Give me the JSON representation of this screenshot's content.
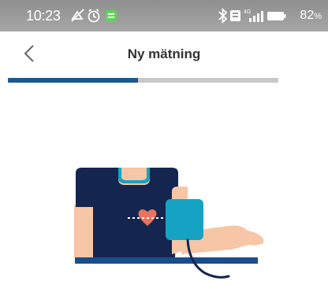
{
  "status_bar": {
    "time": "10:23",
    "battery_percent": "82",
    "network": "4G",
    "left_icons": [
      "notifications-off-icon",
      "alarm-icon",
      "app-notification-icon"
    ],
    "right_icons": [
      "bluetooth-icon",
      "nfc-icon",
      "signal-icon",
      "battery-icon"
    ]
  },
  "header": {
    "title": "Ny mätning",
    "back_icon": "chevron-left-icon"
  },
  "progress": {
    "fraction": 0.48,
    "fill_color": "#1a5a8e",
    "track_color": "#c8c8c8"
  },
  "illustration": {
    "subject": "person-with-blood-pressure-cuff",
    "colors": {
      "shirt": "#14264f",
      "skin": "#f6c6a6",
      "cuff": "#16a3c3",
      "heart": "#e8735f",
      "table": "#1a4d8c"
    }
  }
}
